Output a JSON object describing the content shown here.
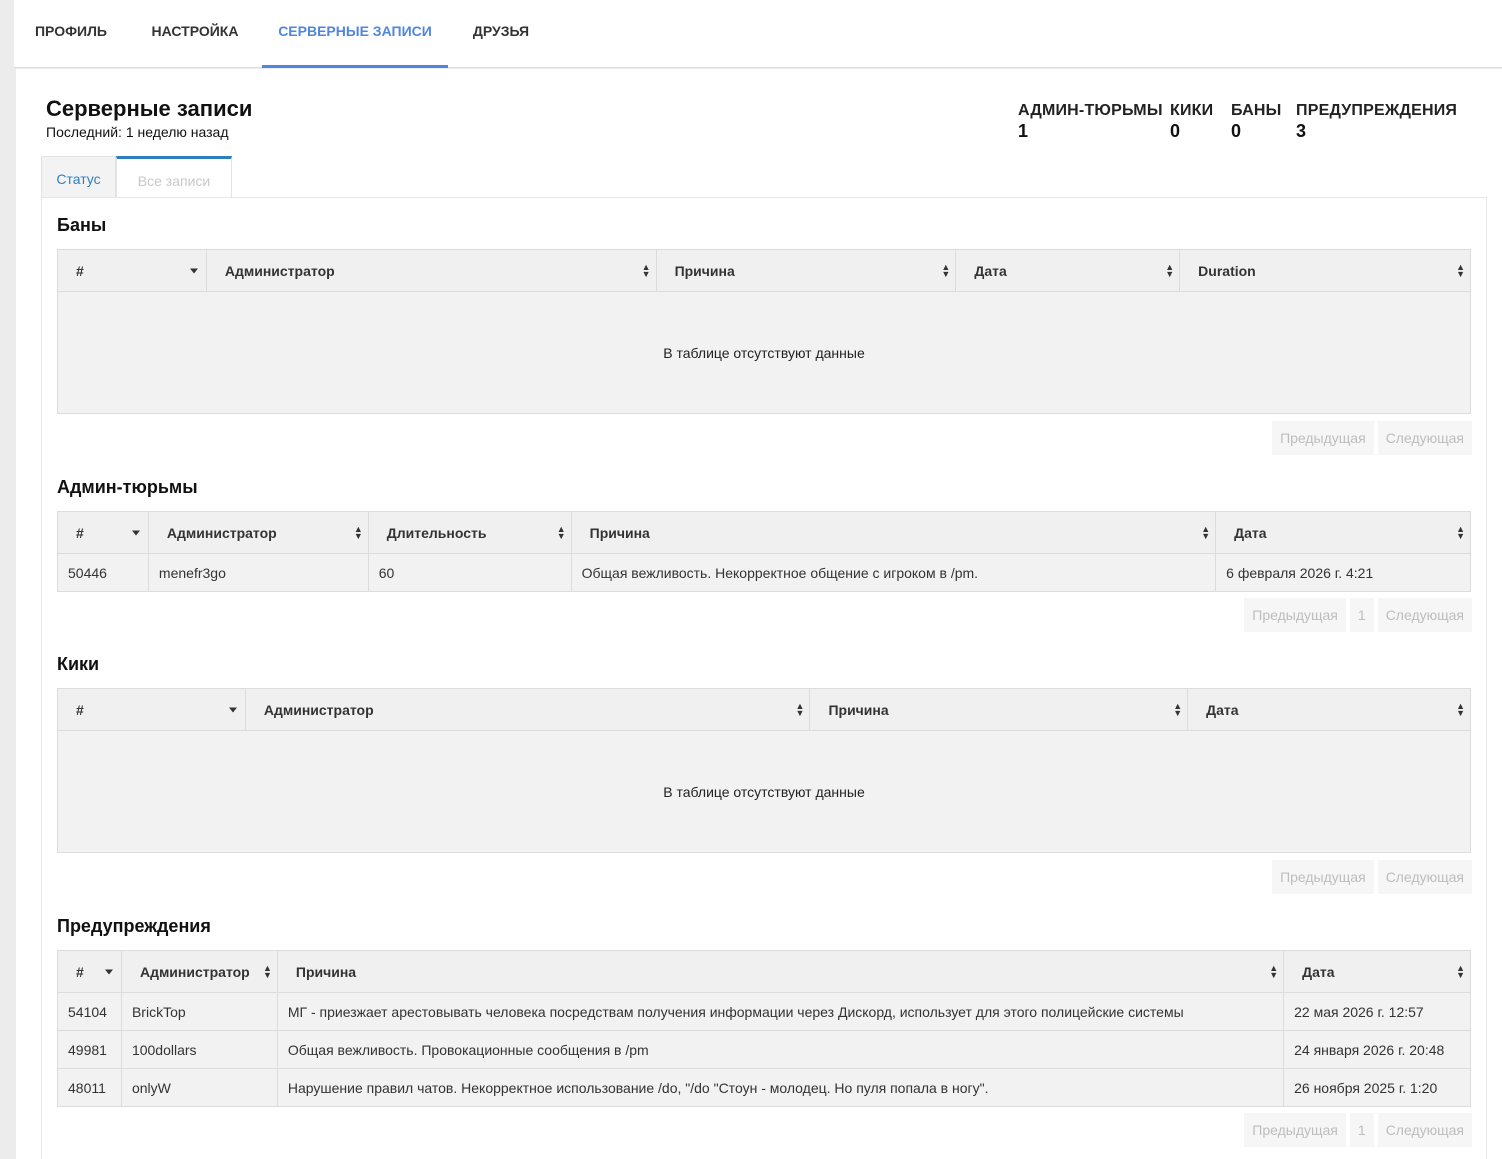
{
  "nav": {
    "tabs": [
      {
        "label": "ПРОФИЛЬ"
      },
      {
        "label": "НАСТРОЙКА"
      },
      {
        "label": "СЕРВЕРНЫЕ ЗАПИСИ",
        "active": true
      },
      {
        "label": "ДРУЗЬЯ"
      }
    ]
  },
  "header": {
    "title": "Серверные записи",
    "subtitle": "Последний: 1 неделю назад"
  },
  "stats": [
    {
      "label": "АДМИН-ТЮРЬМЫ",
      "value": "1"
    },
    {
      "label": "КИКИ",
      "value": "0"
    },
    {
      "label": "БАНЫ",
      "value": "0"
    },
    {
      "label": "ПРЕДУПРЕЖДЕНИЯ",
      "value": "3"
    }
  ],
  "subtabs": [
    {
      "label": "Статус"
    },
    {
      "label": "Все записи",
      "active": true
    }
  ],
  "bans": {
    "title": "Баны",
    "columns": [
      "#",
      "Администратор",
      "Причина",
      "Дата",
      "Duration"
    ],
    "empty_text": "В таблице отсутствуют данные",
    "pager": {
      "prev": "Предыдущая",
      "next": "Следующая"
    }
  },
  "jails": {
    "title": "Админ-тюрьмы",
    "columns": [
      "#",
      "Администратор",
      "Длительность",
      "Причина",
      "Дата"
    ],
    "rows": [
      [
        "50446",
        "menefr3go",
        "60",
        "Общая вежливость. Некорректное общение с игроком в /pm.",
        "6 февраля 2026 г. 4:21"
      ]
    ],
    "pager": {
      "prev": "Предыдущая",
      "page": "1",
      "next": "Следующая"
    }
  },
  "kicks": {
    "title": "Кики",
    "columns": [
      "#",
      "Администратор",
      "Причина",
      "Дата"
    ],
    "empty_text": "В таблице отсутствуют данные",
    "pager": {
      "prev": "Предыдущая",
      "next": "Следующая"
    }
  },
  "warnings": {
    "title": "Предупреждения",
    "columns": [
      "#",
      "Администратор",
      "Причина",
      "Дата"
    ],
    "rows": [
      [
        "54104",
        "BrickTop",
        "МГ - приезжает арестовывать человека посредствам получения информации через Дискорд, использует для этого полицейские системы",
        "22 мая 2026 г. 12:57"
      ],
      [
        "49981",
        "100dollars",
        "Общая вежливость. Провокационные сообщения в /pm",
        "24 января 2026 г. 20:48"
      ],
      [
        "48011",
        "onlyW",
        "Нарушение правил чатов. Некорректное использование /do, \"/do \"Стоун - молодец. Но пуля попала в ногу\".",
        "26 ноября 2025 г. 1:20"
      ]
    ],
    "pager": {
      "prev": "Предыдущая",
      "page": "1",
      "next": "Следующая"
    }
  },
  "colors": {
    "accent": "#4f86e0",
    "subtab_accent": "#2e7fc2",
    "table_bg": "#f2f2f2"
  }
}
